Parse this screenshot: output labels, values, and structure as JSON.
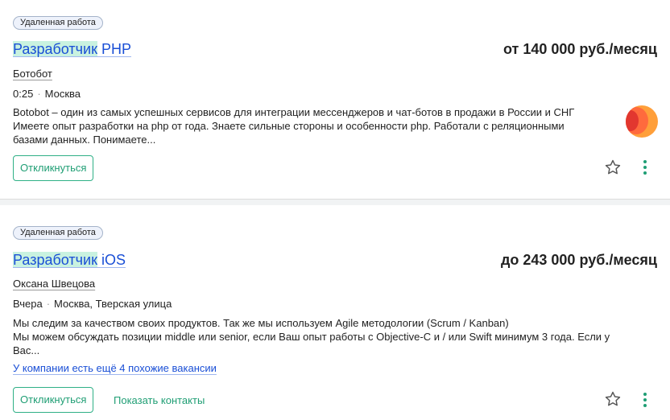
{
  "vacancies": [
    {
      "badge": "Удаленная работа",
      "title_highlight": "Разработчик",
      "title_rest": " PHP",
      "salary": "от 140 000 руб./месяц",
      "company": "Ботобот",
      "time": "0:25",
      "location": "Москва",
      "description_lines": [
        "Botobot – один из самых успешных сервисов для интеграции мессенджеров и чат-ботов в продажи в России и СНГ",
        "Имеете опыт разработки на php от года. Знаете сильные стороны и особенности php. Работали с реляционными",
        "базами данных. Понимаете..."
      ],
      "respond_label": "Откликнуться",
      "logo_icon": "botobot-logo"
    },
    {
      "badge": "Удаленная работа",
      "title_highlight": "Разработчик",
      "title_rest": " iOS",
      "salary": "до 243 000 руб./месяц",
      "company": "Оксана Швецова",
      "time": "Вчера",
      "location": "Москва, Тверская улица",
      "description_lines": [
        "Мы следим за качеством своих продуктов. Так же мы используем Agile методологии (Scrum / Kanban)",
        "Мы можем обсуждать позиции middle или senior, если Ваш опыт работы с Objective-C и / или Swift минимум 3 года. Если у",
        "Вас..."
      ],
      "similar_link": "У компании есть ещё 4 похожие вакансии",
      "respond_label": "Откликнуться",
      "contacts_label": "Показать контакты"
    }
  ],
  "colors": {
    "link": "#1a4fd6",
    "highlight": "#c9f2e0",
    "accent_green": "#1f9e74",
    "badge_bg": "#eef2fb"
  },
  "icons": {
    "favorite": "star-icon",
    "more": "kebab-menu-icon"
  }
}
